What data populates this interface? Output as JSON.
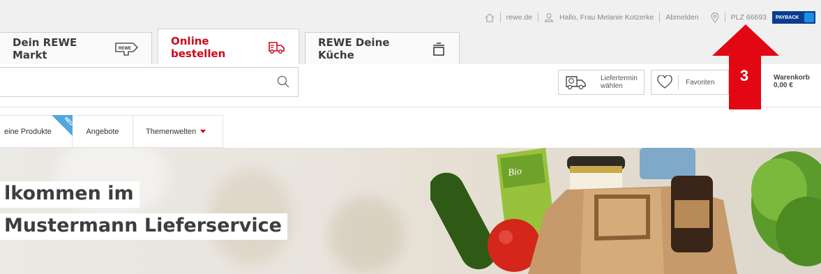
{
  "utility": {
    "home_link": "rewe.de",
    "greeting": "Hallo, Frau Melanie Kotzerke",
    "logout": "Abmelden",
    "plz": "PLZ 66693",
    "payback": "PAYBACK"
  },
  "tabs": [
    {
      "label": "Dein REWE Markt",
      "icon": "rewe-logo-icon"
    },
    {
      "label": "Online bestellen",
      "icon": "delivery-truck-icon",
      "active": true
    },
    {
      "label": "REWE Deine Küche",
      "icon": "cooking-pot-icon"
    }
  ],
  "search": {
    "placeholder": ""
  },
  "actions": {
    "delivery_line1": "Liefertermin",
    "delivery_line2": "wählen",
    "favorites": "Favoriten",
    "cart_line1": "Warenkorb",
    "cart_line2": "0,00 €"
  },
  "nav": {
    "items": [
      "eine Produkte",
      "Angebote",
      "Themenwelten"
    ],
    "badge": "NEU"
  },
  "hero": {
    "line1": "lkommen im",
    "line2": "Mustermann Lieferservice"
  },
  "annotation": {
    "number": "3",
    "color": "#e30613"
  },
  "colors": {
    "brand_red": "#cc071e",
    "payback_blue": "#0a3d91",
    "badge_blue": "#4fa7de"
  }
}
